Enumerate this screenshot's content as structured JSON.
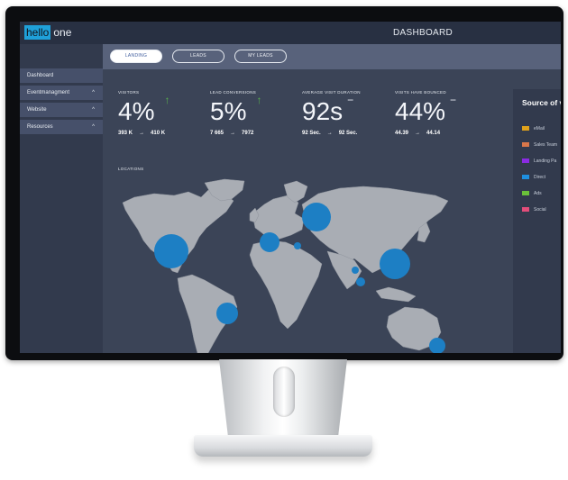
{
  "header": {
    "logo_part1": "hello",
    "logo_part2": "one",
    "title": "DASHBOARD"
  },
  "tabs": [
    {
      "label": "LANDING",
      "active": true
    },
    {
      "label": "LEADS",
      "active": false
    },
    {
      "label": "MY LEADS",
      "active": false
    }
  ],
  "sidebar": {
    "items": [
      {
        "label": "Dashboard",
        "expandable": false
      },
      {
        "label": "Eventmanagment",
        "expandable": true
      },
      {
        "label": "Website",
        "expandable": true
      },
      {
        "label": "Resources",
        "expandable": true
      }
    ],
    "chevron_glyph": "^"
  },
  "kpis": [
    {
      "label": "VISITORS",
      "value": "4%",
      "trend": "up",
      "trend_glyph": "↑",
      "from": "393 K",
      "to": "410 K"
    },
    {
      "label": "LEAD CONVERSIONS",
      "value": "5%",
      "trend": "up",
      "trend_glyph": "↑",
      "from": "7 665",
      "to": "7972"
    },
    {
      "label": "AVERAGE VISIT DURATION",
      "value": "92s",
      "trend": "flat",
      "trend_glyph": "−",
      "from": "92 Sec.",
      "to": "92 Sec."
    },
    {
      "label": "VISITS HAVE BOUNCED",
      "value": "44%",
      "trend": "flat",
      "trend_glyph": "−",
      "from": "44.39",
      "to": "44.14"
    }
  ],
  "range_arrow": "→",
  "locations": {
    "label": "LOCATIONS",
    "bubble_color": "#1d7fc4"
  },
  "source": {
    "title": "Source of v",
    "items": [
      {
        "label": "eMail",
        "color": "#e0a21b"
      },
      {
        "label": "Sales Team",
        "color": "#d9774a"
      },
      {
        "label": "Landing Pa",
        "color": "#8a2be2"
      },
      {
        "label": "Direct",
        "color": "#1e8fe0"
      },
      {
        "label": "Ads",
        "color": "#6ac13a"
      },
      {
        "label": "Social",
        "color": "#e24d7a"
      }
    ]
  }
}
